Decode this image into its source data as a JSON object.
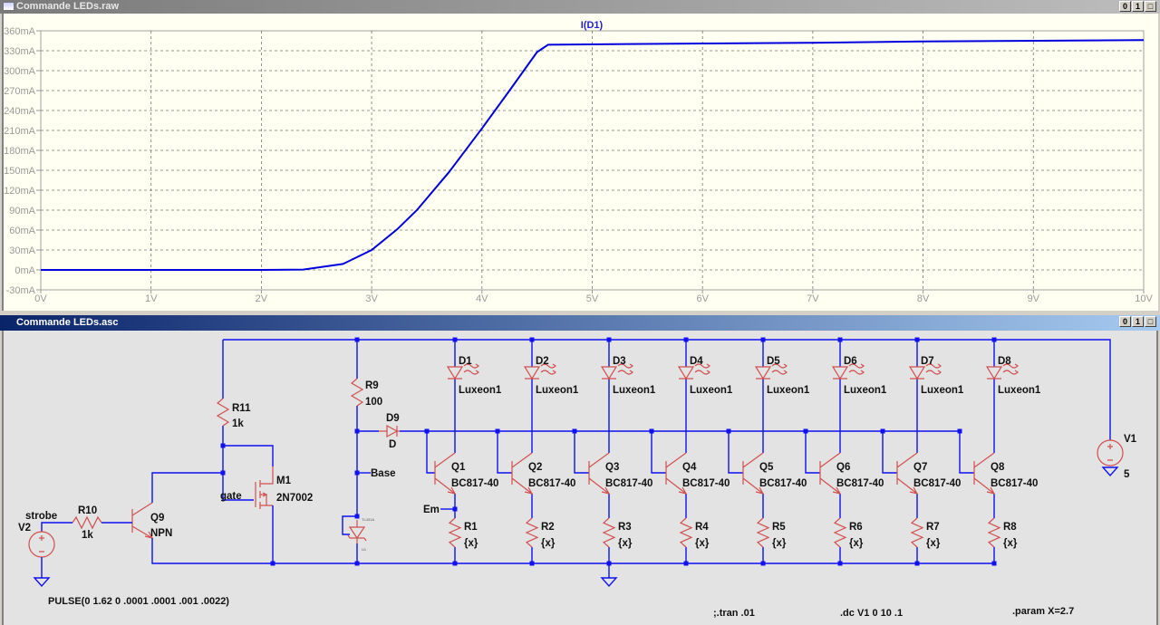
{
  "windows": {
    "raw": {
      "title": "Commande LEDs.raw",
      "buttons": [
        "0",
        "1",
        "□"
      ]
    },
    "asc": {
      "title": "Commande LEDs.asc",
      "buttons": [
        "0",
        "1",
        "□"
      ]
    }
  },
  "colors": {
    "trace": "#0000dd",
    "wire": "#1010f0",
    "component": "#d05050",
    "plot_bg": "#fffff2",
    "schematic_bg": "#e3e3e3"
  },
  "chart_data": {
    "type": "line",
    "title": "I(D1)",
    "xlabel": "",
    "ylabel": "",
    "xlim": [
      0,
      10
    ],
    "ylim": [
      -30,
      360
    ],
    "grid": true,
    "x_ticks": [
      "0V",
      "1V",
      "2V",
      "3V",
      "4V",
      "5V",
      "6V",
      "7V",
      "8V",
      "9V",
      "10V"
    ],
    "y_ticks": [
      "360mA",
      "330mA",
      "300mA",
      "270mA",
      "240mA",
      "210mA",
      "180mA",
      "150mA",
      "120mA",
      "90mA",
      "60mA",
      "30mA",
      "0mA",
      "-30mA"
    ],
    "y_tick_values": [
      360,
      330,
      300,
      270,
      240,
      210,
      180,
      150,
      120,
      90,
      60,
      30,
      0,
      -30
    ],
    "series": [
      {
        "name": "I(D1)",
        "x": [
          0,
          2.0,
          2.38,
          2.74,
          3.0,
          3.23,
          3.41,
          3.7,
          4.0,
          4.25,
          4.5,
          4.6,
          5.2,
          7,
          8,
          10
        ],
        "y": [
          0,
          0,
          0.5,
          9,
          30,
          61,
          90,
          147,
          213,
          270,
          328,
          339,
          340,
          342,
          344,
          346
        ]
      }
    ]
  },
  "schematic": {
    "v2": {
      "name": "V2",
      "net": "strobe"
    },
    "r10": {
      "name": "R10",
      "value": "1k"
    },
    "q9": {
      "name": "Q9",
      "model": "NPN"
    },
    "r11": {
      "name": "R11",
      "value": "1k"
    },
    "m1": {
      "name": "M1",
      "model": "2N7002",
      "net": "gate"
    },
    "r9": {
      "name": "R9",
      "value": "100"
    },
    "d9": {
      "name": "D9",
      "model": "D"
    },
    "base_net": "Base",
    "em_net": "Em",
    "u1": {
      "name": "U1",
      "model": "TL431A"
    },
    "v1": {
      "name": "V1",
      "value": "5"
    },
    "channels": [
      {
        "led": "D1",
        "led_model": "Luxeon1",
        "q": "Q1",
        "q_model": "BC817-40",
        "r": "R1",
        "r_value": "{x}"
      },
      {
        "led": "D2",
        "led_model": "Luxeon1",
        "q": "Q2",
        "q_model": "BC817-40",
        "r": "R2",
        "r_value": "{x}"
      },
      {
        "led": "D3",
        "led_model": "Luxeon1",
        "q": "Q3",
        "q_model": "BC817-40",
        "r": "R3",
        "r_value": "{x}"
      },
      {
        "led": "D4",
        "led_model": "Luxeon1",
        "q": "Q4",
        "q_model": "BC817-40",
        "r": "R4",
        "r_value": "{x}"
      },
      {
        "led": "D5",
        "led_model": "Luxeon1",
        "q": "Q5",
        "q_model": "BC817-40",
        "r": "R5",
        "r_value": "{x}"
      },
      {
        "led": "D6",
        "led_model": "Luxeon1",
        "q": "Q6",
        "q_model": "BC817-40",
        "r": "R6",
        "r_value": "{x}"
      },
      {
        "led": "D7",
        "led_model": "Luxeon1",
        "q": "Q7",
        "q_model": "BC817-40",
        "r": "R7",
        "r_value": "{x}"
      },
      {
        "led": "D8",
        "led_model": "Luxeon1",
        "q": "Q8",
        "q_model": "BC817-40",
        "r": "R8",
        "r_value": "{x}"
      }
    ],
    "directives": {
      "pulse": "PULSE(0 1.62 0 .0001 .0001 .001 .0022)",
      "tran": ";.tran .01",
      "dc": ".dc V1 0 10 .1",
      "param": ".param X=2.7"
    }
  }
}
